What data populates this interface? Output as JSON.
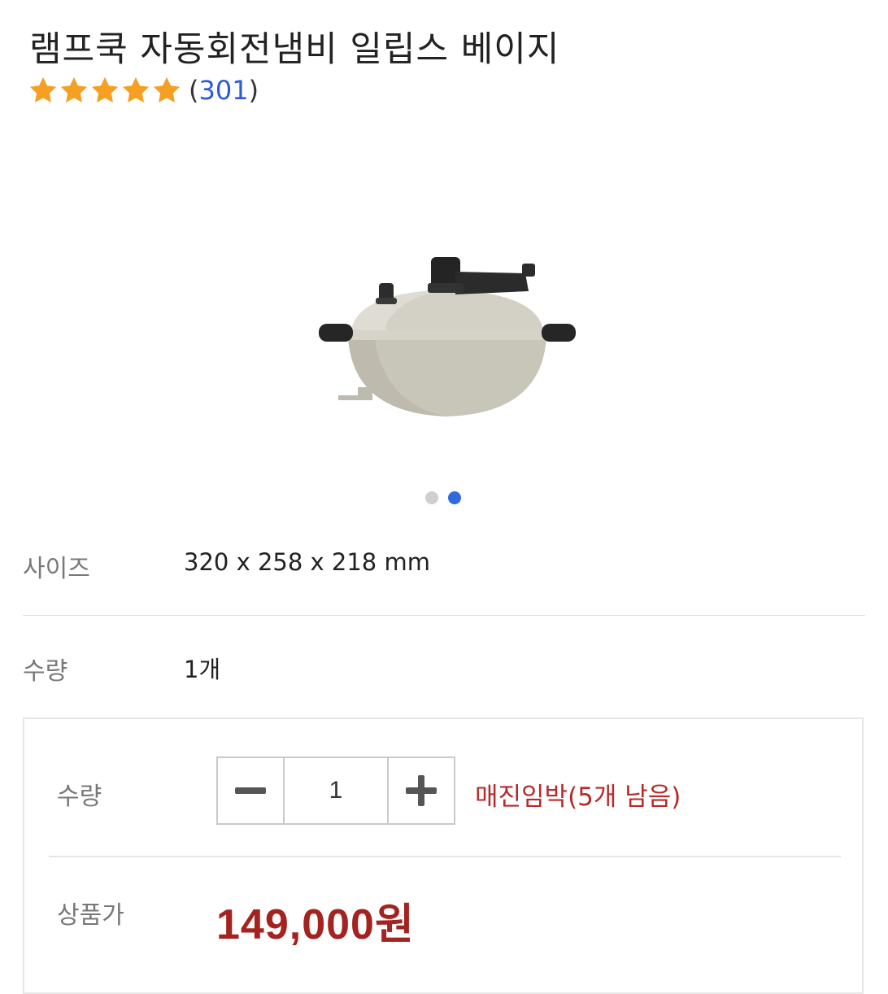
{
  "product": {
    "title": "램프쿡 자동회전냄비 일립스 베이지",
    "rating": {
      "stars": 5,
      "count_open": "(",
      "count": "301",
      "count_close": ")"
    },
    "image": {
      "icon": "pot-image",
      "slide_count": 2,
      "active_slide": 2
    }
  },
  "info": {
    "size_label": "사이즈",
    "size_value": "320 x 258 x 218 mm",
    "qty_label": "수량",
    "qty_value": "1개"
  },
  "order": {
    "qty_label": "수량",
    "qty_value": "1",
    "stock_note": "매진임박(5개 남음)",
    "price_label": "상품가",
    "price": "149,000원"
  },
  "colors": {
    "star": "#f5a023",
    "link_blue": "#2a5bd7",
    "stock_red": "#b62a2a",
    "price_red": "#a4221f",
    "active_dot": "#2f6ae0"
  }
}
